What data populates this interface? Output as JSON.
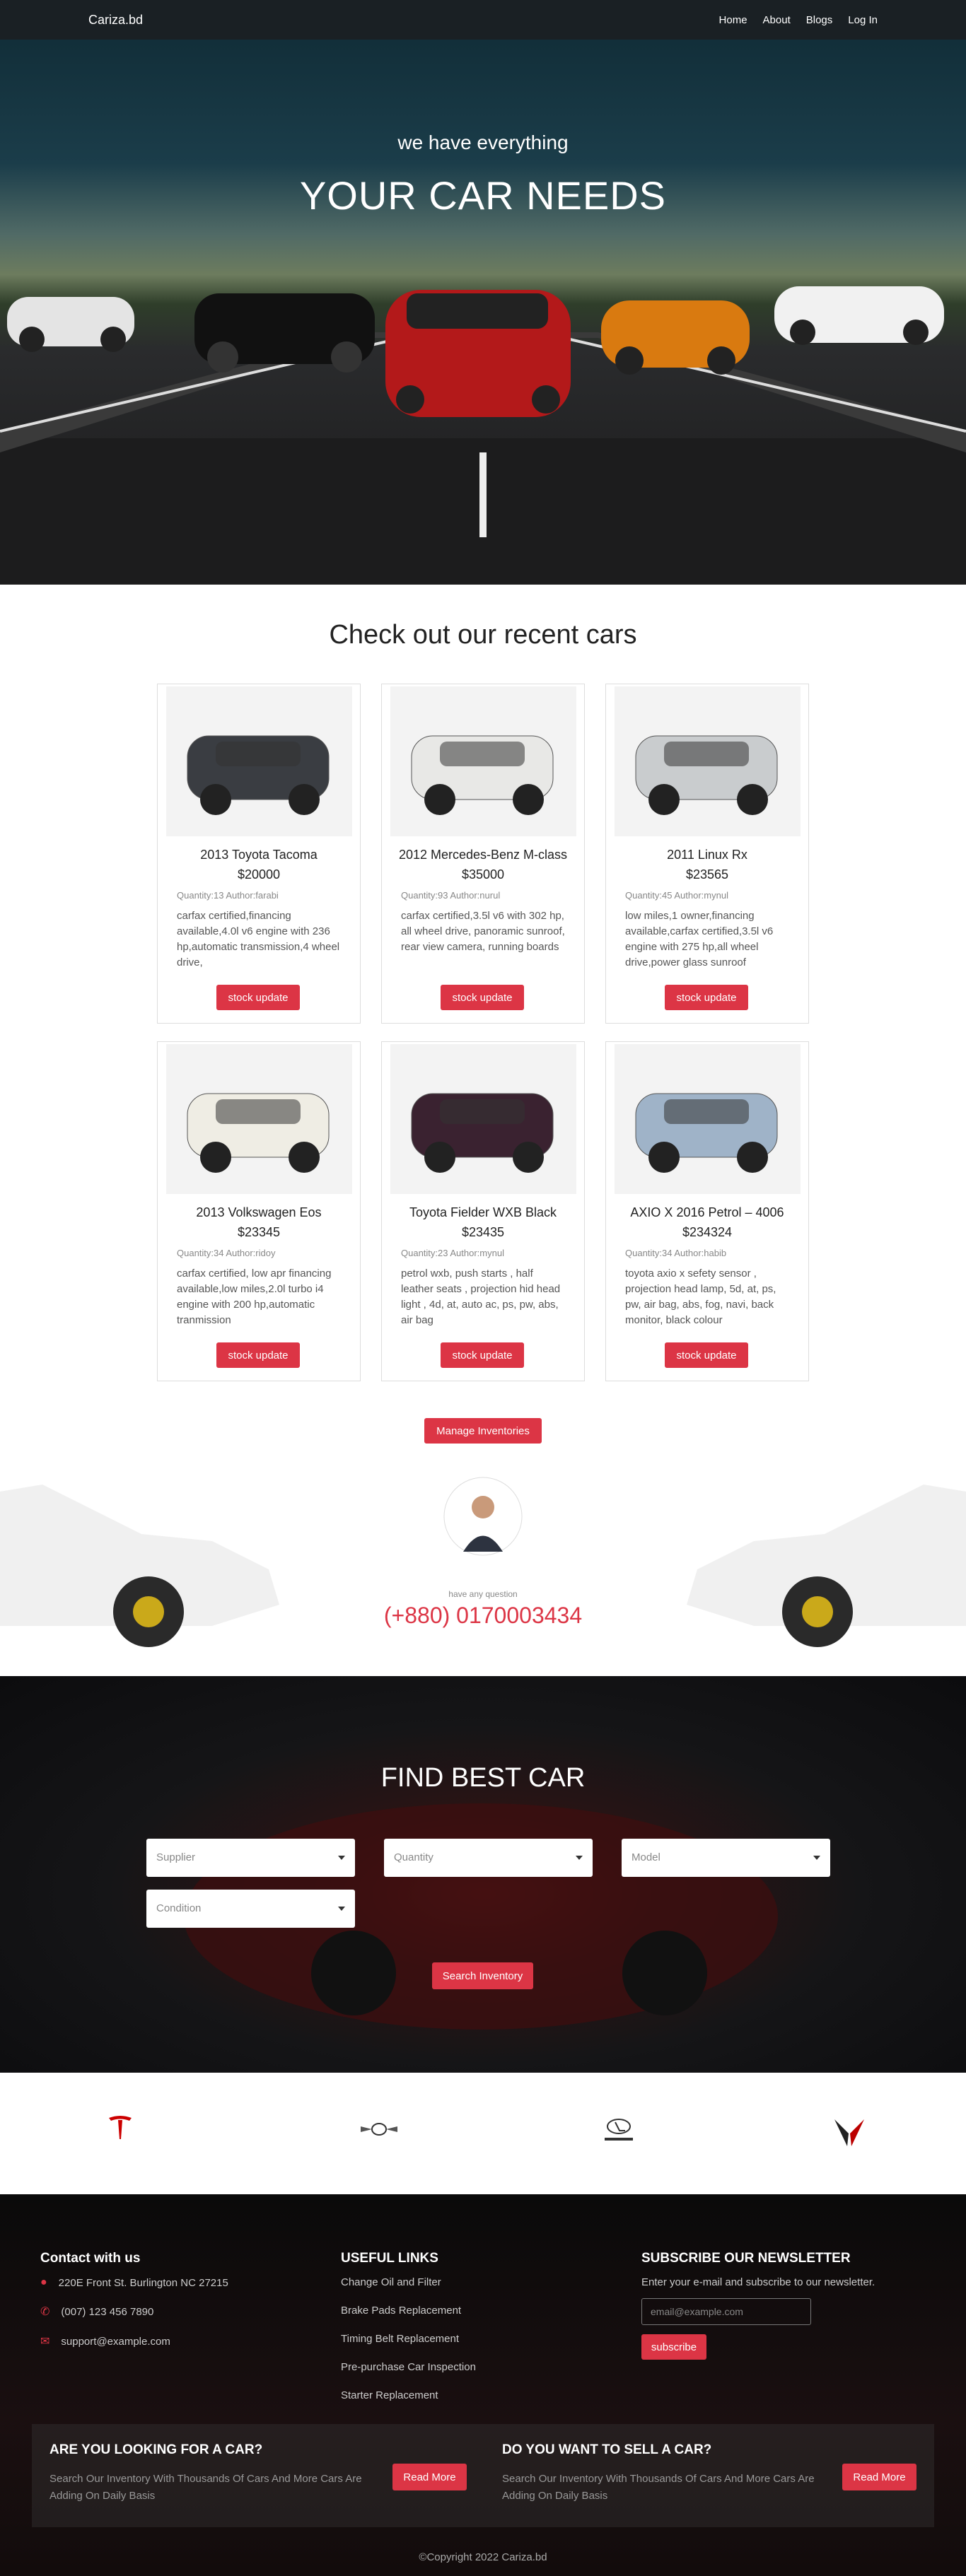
{
  "nav": {
    "brand": "Cariza.bd",
    "links": [
      "Home",
      "About",
      "Blogs",
      "Log In"
    ]
  },
  "hero": {
    "subtitle": "we have everything",
    "title": "YOUR CAR NEEDS"
  },
  "recent": {
    "title": "Check out our recent cars",
    "button_label": "stock update",
    "cars": [
      {
        "name": "2013 Toyota Tacoma",
        "price": "$20000",
        "meta": "Quantity:13 Author:farabi",
        "desc": "carfax certified,financing available,4.0l v6 engine with 236 hp,automatic transmission,4 wheel drive,",
        "color": "#3a3d42"
      },
      {
        "name": "2012 Mercedes-Benz M-class",
        "price": "$35000",
        "meta": "Quantity:93 Author:nurul",
        "desc": "carfax certified,3.5l v6 with 302 hp, all wheel drive, panoramic sunroof, rear view camera, running boards",
        "color": "#e8e8e6"
      },
      {
        "name": "2011 Linux Rx",
        "price": "$23565",
        "meta": "Quantity:45 Author:mynul",
        "desc": "low miles,1 owner,financing available,carfax certified,3.5l v6 engine with 275 hp,all wheel drive,power glass sunroof",
        "color": "#c9ccce"
      },
      {
        "name": "2013 Volkswagen Eos",
        "price": "$23345",
        "meta": "Quantity:34 Author:ridoy",
        "desc": "carfax certified, low apr financing available,low miles,2.0l turbo i4 engine with 200 hp,automatic tranmission",
        "color": "#efede4"
      },
      {
        "name": "Toyota Fielder WXB Black",
        "price": "$23435",
        "meta": "Quantity:23 Author:mynul",
        "desc": "petrol wxb, push starts , half leather seats , projection hid head light , 4d, at, auto ac, ps, pw, abs, air bag",
        "color": "#3a2230"
      },
      {
        "name": "AXIO X 2016 Petrol – 4006",
        "price": "$234324",
        "meta": "Quantity:34 Author:habib",
        "desc": "toyota axio x sefety sensor , projection head lamp, 5d, at, ps, pw, air bag, abs, fog, navi, back monitor, black colour",
        "color": "#9fb3c8"
      }
    ]
  },
  "manage_label": "Manage Inventories",
  "contact": {
    "question": "have any question",
    "phone": "(+880) 0170003434"
  },
  "find": {
    "title": "FIND BEST CAR",
    "selects": [
      "Supplier",
      "Quantity",
      "Model",
      "Condition"
    ],
    "button_label": "Search Inventory"
  },
  "brands": [
    "tesla-logo",
    "mini-logo",
    "lexus-logo",
    "corvette-logo"
  ],
  "footer": {
    "contact_title": "Contact with us",
    "address": "220E Front St. Burlington NC 27215",
    "phone": "(007) 123 456 7890",
    "email": "support@example.com",
    "links_title": "USEFUL LINKS",
    "links": [
      "Change Oil and Filter",
      "Brake Pads Replacement",
      "Timing Belt Replacement",
      "Pre-purchase Car Inspection",
      "Starter Replacement"
    ],
    "newsletter_title": "SUBSCRIBE OUR NEWSLETTER",
    "newsletter_text": "Enter your e-mail and subscribe to our newsletter.",
    "email_placeholder": "email@example.com",
    "subscribe_label": "subscribe",
    "promo_left_title": "ARE YOU LOOKING FOR A CAR?",
    "promo_left_text": "Search Our Inventory With Thousands Of Cars And More Cars Are Adding On Daily Basis",
    "promo_right_title": "DO YOU WANT TO SELL A CAR?",
    "promo_right_text": "Search Our Inventory With Thousands Of Cars And More Cars Are Adding On Daily Basis",
    "read_more_label": "Read More",
    "copyright": "©Copyright 2022 Cariza.bd"
  },
  "colors": {
    "accent": "#dc3545",
    "nav_bg": "#1a2024"
  }
}
